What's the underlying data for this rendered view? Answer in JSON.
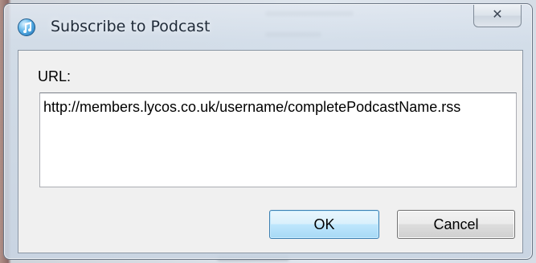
{
  "window": {
    "title": "Subscribe to Podcast",
    "close_glyph": "✕",
    "icon": "itunes-icon"
  },
  "form": {
    "url_label": "URL:",
    "url_value": "http://members.lycos.co.uk/username/completePodcastName.rss"
  },
  "buttons": {
    "ok_label": "OK",
    "cancel_label": "Cancel"
  },
  "colors": {
    "default_button_border": "#3c7fb1",
    "glass_frame": "#d2dde9"
  }
}
